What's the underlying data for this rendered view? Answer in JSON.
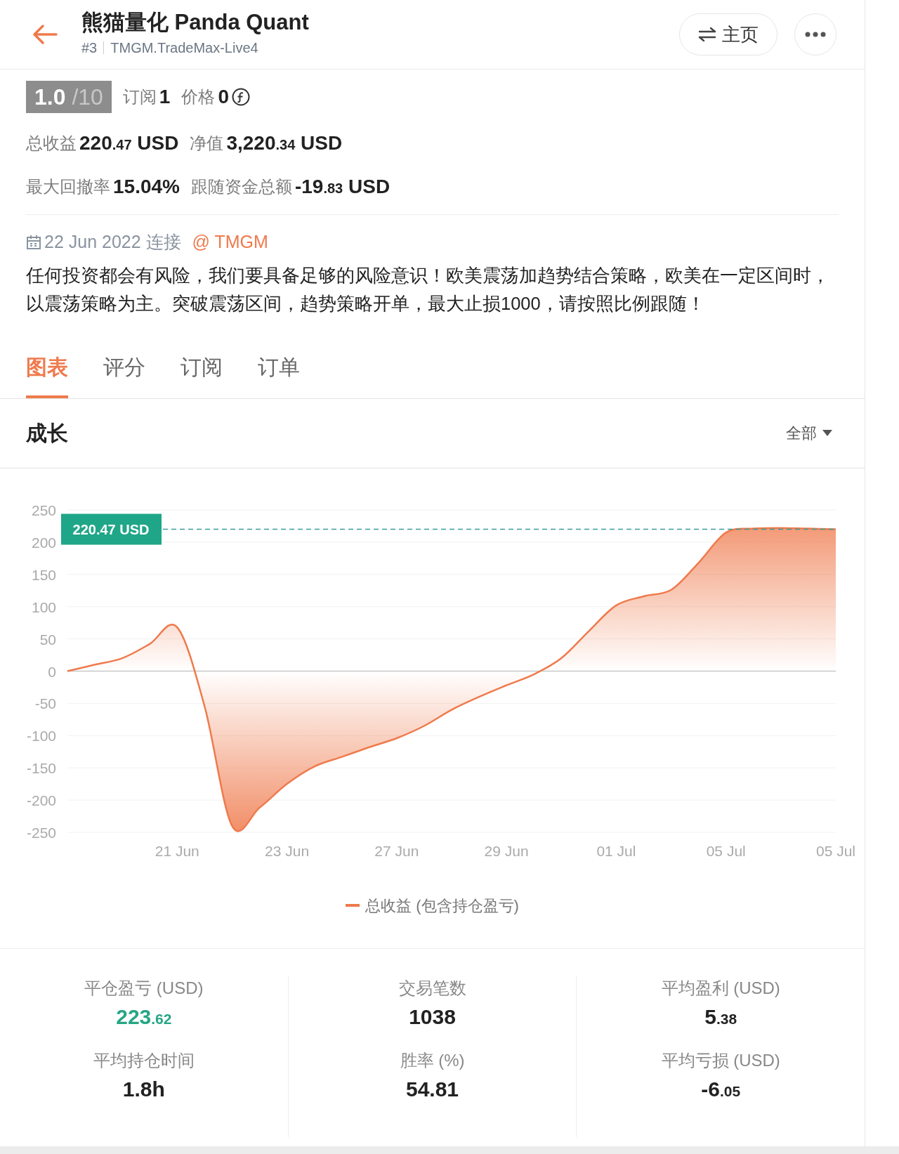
{
  "header": {
    "title": "熊猫量化 Panda Quant",
    "account_no": "#3",
    "server": "TMGM.TradeMax-Live4",
    "home_button": "主页"
  },
  "summary": {
    "score": "1.0",
    "score_max": "/10",
    "subscriptions_label": "订阅",
    "subscriptions": "1",
    "price_label": "价格",
    "price": "0",
    "metric_rows": [
      [
        {
          "label": "总收益",
          "main": "220",
          "minor": ".47",
          "unit": "USD"
        },
        {
          "label": "净值",
          "main": "3,220",
          "minor": ".34",
          "unit": "USD"
        }
      ],
      [
        {
          "label": "最大回撤率",
          "main": "15.04%"
        },
        {
          "label": "跟随资金总额",
          "main": "-19",
          "minor": ".83",
          "unit": "USD"
        }
      ]
    ]
  },
  "connection": {
    "date": "22 Jun 2022 连接",
    "broker": "@ TMGM"
  },
  "description": "任何投资都会有风险，我们要具备足够的风险意识！欧美震荡加趋势结合策略，欧美在一定区间时，以震荡策略为主。突破震荡区间，趋势策略开单，最大止损1000，请按照比例跟随！",
  "tabs": [
    {
      "label": "图表",
      "selected": true
    },
    {
      "label": "评分",
      "selected": false
    },
    {
      "label": "订阅",
      "selected": false
    },
    {
      "label": "订单",
      "selected": false
    }
  ],
  "growth": {
    "title": "成长",
    "range": "全部",
    "chart_data": {
      "type": "line",
      "categories": [
        null,
        null,
        null,
        null,
        "21 Jun",
        null,
        null,
        null,
        "23 Jun",
        null,
        null,
        null,
        "27 Jun",
        null,
        null,
        null,
        "29 Jun",
        null,
        null,
        null,
        "01 Jul",
        null,
        null,
        null,
        "05 Jul",
        null,
        null,
        null,
        "05 Jul"
      ],
      "series": [
        {
          "name": "总收益 (包含持仓盈亏)",
          "color": "#ef7a4c",
          "values": [
            0,
            10,
            20,
            42,
            68,
            -55,
            -240,
            -212,
            -175,
            -148,
            -133,
            -118,
            -104,
            -85,
            -60,
            -40,
            -22,
            -5,
            20,
            62,
            102,
            116,
            126,
            168,
            215,
            221,
            222,
            221,
            220
          ]
        }
      ],
      "ylim": [
        -250,
        250
      ],
      "yticks": [
        250,
        200,
        150,
        100,
        50,
        0,
        -50,
        -100,
        -150,
        -200,
        -250
      ],
      "grid": true,
      "ref_lines": [
        {
          "axis": "y",
          "value": 220
        }
      ],
      "annotations": [
        "220.47 USD"
      ]
    }
  },
  "stat_columns": [
    [
      {
        "label": "平仓盈亏 (USD)",
        "main": "223",
        "minor": ".62",
        "highlighted": true
      },
      {
        "label": "平均持仓时间",
        "main": "1.8h",
        "highlighted": false
      }
    ],
    [
      {
        "label": "交易笔数",
        "main": "1038",
        "highlighted": false
      },
      {
        "label": "胜率 (%)",
        "main": "54.81",
        "highlighted": false
      }
    ],
    [
      {
        "label": "平均盈利 (USD)",
        "main": "5",
        "minor": ".38",
        "highlighted": false
      },
      {
        "label": "平均亏损 (USD)",
        "main": "-6",
        "minor": ".05",
        "highlighted": false
      }
    ]
  ]
}
